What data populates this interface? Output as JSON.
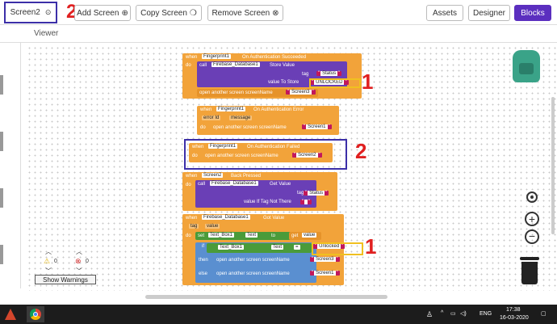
{
  "toolbar": {
    "screen_name": "Screen2",
    "add_screen": "Add Screen",
    "copy_screen": "Copy Screen",
    "remove_screen": "Remove Screen",
    "assets": "Assets",
    "designer": "Designer",
    "blocks": "Blocks"
  },
  "viewer": {
    "title": "Viewer"
  },
  "annotations": {
    "one": "1",
    "two": "2"
  },
  "blocks": {
    "b1": {
      "when": "when",
      "comp": "Fingerprint1",
      "event": "On Authentication Succeeded",
      "do": "do",
      "call": "call",
      "db": "Firebase_Database1",
      "method": "Store Value",
      "tag": "tag",
      "tag_val": "Status",
      "vts": "value To Store",
      "vts_val": "UNLOCKED",
      "open": "open another screen  screenName",
      "screen": "Screen3"
    },
    "b2": {
      "when": "when",
      "comp": "Fingerprint1",
      "event": "On Authentication Error",
      "p1": "error Id",
      "p2": "message",
      "do": "do",
      "open": "open another screen  screenName",
      "screen": "Screen1"
    },
    "b3": {
      "when": "when",
      "comp": "Fingerprint1",
      "event": "On Authentication Failed",
      "do": "do",
      "open": "open another screen  screenName",
      "screen": "Screen2"
    },
    "b4": {
      "when": "when",
      "comp": "Screen2",
      "event": "Back Pressed",
      "do": "do",
      "call": "call",
      "db": "Firebase_Database1",
      "method": "Get Value",
      "tag": "tag",
      "tag_val": "Status",
      "vit": "value If Tag Not There",
      "vit_val": ""
    },
    "b5": {
      "when": "when",
      "comp": "Firebase_Database1",
      "event": "Got Value",
      "p1": "tag",
      "p2": "value",
      "do": "do",
      "set": "set",
      "tb": "Text_Box1",
      "textp": "Text",
      "to": "to",
      "get": "get",
      "getv": "value",
      "if": "if",
      "tb2": "Text_Box1",
      "textp2": "Text",
      "eq": "=",
      "unl": "Unlocked",
      "then": "then",
      "open1": "open another screen  screenName",
      "s1": "Screen3",
      "else": "else",
      "open2": "open another screen  screenName",
      "s2": "Screen1"
    }
  },
  "warnings": {
    "warn_count": "0",
    "err_count": "0",
    "show": "Show Warnings"
  },
  "taskbar": {
    "eng": "ENG",
    "time": "17:38",
    "date": "16-03-2020"
  },
  "colors": {
    "accent": "#5b2fbf",
    "event": "#f2a33a",
    "procedure": "#6a3fb6",
    "text": "#c2185b",
    "annotation": "#e02020"
  }
}
